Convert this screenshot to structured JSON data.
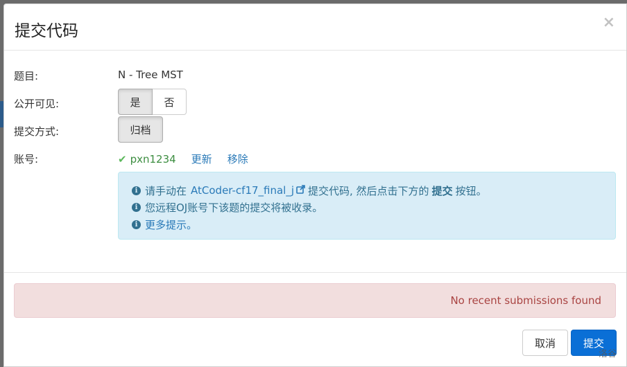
{
  "modal": {
    "title": "提交代码",
    "close_symbol": "×"
  },
  "form": {
    "problem_label": "题目:",
    "problem_value": "N - Tree MST",
    "visibility_label": "公开可见:",
    "visibility_options": [
      "是",
      "否"
    ],
    "visibility_selected": "是",
    "method_label": "提交方式:",
    "method_value": "归档",
    "account_label": "账号:",
    "account_check_symbol": "✔",
    "account_name": "pxn1234",
    "account_update_link": "更新",
    "account_remove_link": "移除"
  },
  "info": {
    "line1_prefix": "请手动在",
    "line1_link": "AtCoder-cf17_final_j",
    "line1_link_icon": "external-link-icon",
    "line1_middle": "提交代码, 然后点击下方的",
    "line1_bold": "提交",
    "line1_suffix": "按钮。",
    "line2": "您远程OJ账号下该题的提交将被收录。",
    "line3_link": "更多提示。",
    "icon_glyph": "i"
  },
  "alert": {
    "message": "No recent submissions found"
  },
  "footer": {
    "cancel_label": "取消",
    "submit_label": "提交"
  },
  "watermark": "洛谷",
  "colors": {
    "primary": "#0a6fd6",
    "info_bg": "#d9edf7",
    "danger_bg": "#f2dede",
    "success": "#5cb85c"
  }
}
